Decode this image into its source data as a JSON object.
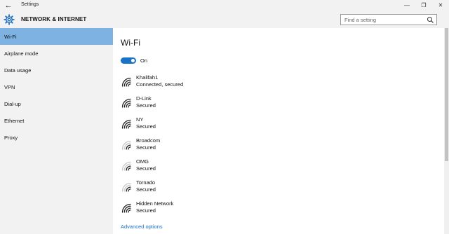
{
  "window": {
    "title": "Settings",
    "back_glyph": "←",
    "min_glyph": "—",
    "max_glyph": "❐",
    "close_glyph": "✕"
  },
  "header": {
    "section": "NETWORK & INTERNET",
    "icon": "gear-icon",
    "search_placeholder": "Find a setting"
  },
  "sidebar": {
    "items": [
      {
        "label": "Wi-Fi",
        "active": true
      },
      {
        "label": "Airplane mode"
      },
      {
        "label": "Data usage"
      },
      {
        "label": "VPN"
      },
      {
        "label": "Dial-up"
      },
      {
        "label": "Ethernet"
      },
      {
        "label": "Proxy"
      }
    ]
  },
  "main": {
    "title": "Wi-Fi",
    "toggle_label": "On",
    "networks": [
      {
        "name": "Khalifah1",
        "status": "Connected, secured",
        "signal": "full"
      },
      {
        "name": "D-Link",
        "status": "Secured",
        "signal": "full"
      },
      {
        "name": "NY",
        "status": "Secured",
        "signal": "full"
      },
      {
        "name": "Broadcom",
        "status": "Secured",
        "signal": "weak"
      },
      {
        "name": "OMG",
        "status": "Secured",
        "signal": "weak"
      },
      {
        "name": "Tornado",
        "status": "Secured",
        "signal": "weak"
      },
      {
        "name": "Hidden Network",
        "status": "Secured",
        "signal": "full"
      }
    ],
    "advanced_link": "Advanced options"
  },
  "colors": {
    "accent": "#1a73c6",
    "selected_nav": "#7eb2e2",
    "chrome": "#f2f2f2"
  }
}
